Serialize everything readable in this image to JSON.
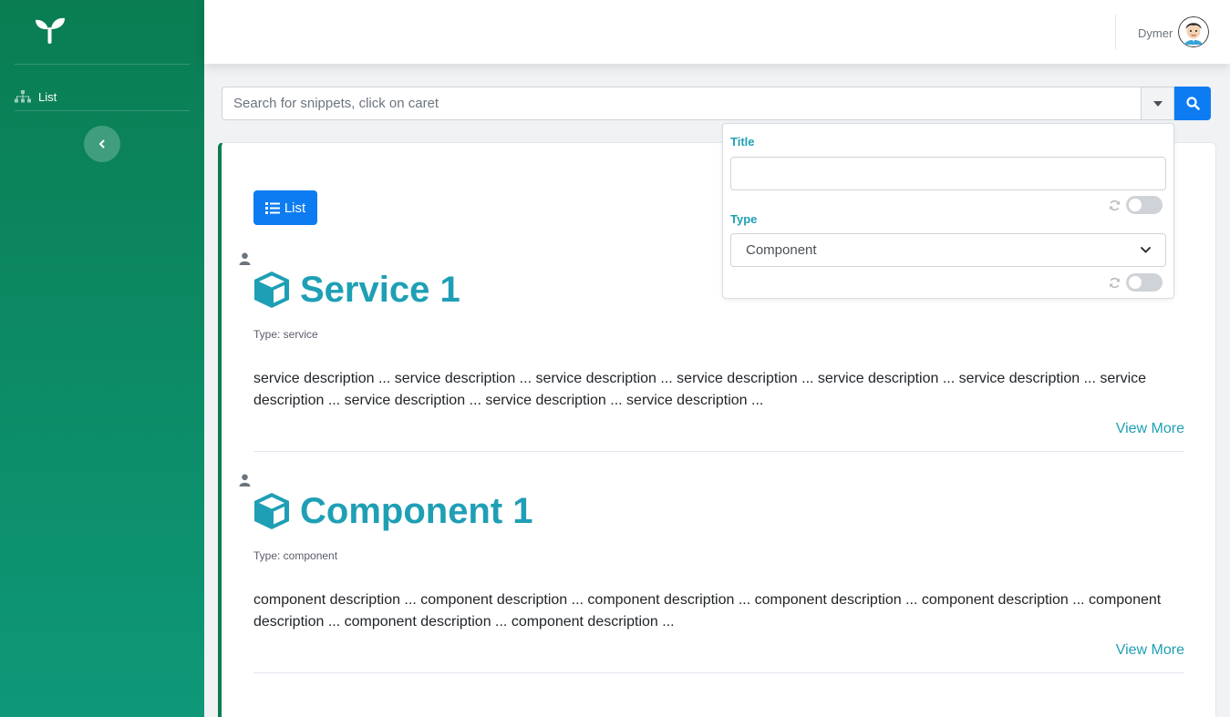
{
  "sidebar": {
    "brand_icon": "sprout-icon",
    "items": [
      {
        "label": "List",
        "icon": "sitemap-icon"
      }
    ],
    "collapse_icon": "chevron-left-icon"
  },
  "topbar": {
    "user_name": "Dymer",
    "avatar_icon": "user-avatar"
  },
  "search": {
    "placeholder": "Search for snippets, click on caret",
    "caret_icon": "caret-down-icon",
    "button_icon": "search-icon"
  },
  "filter_panel": {
    "title_label": "Title",
    "title_value": "",
    "type_label": "Type",
    "type_selected": "Component"
  },
  "main": {
    "list_button_label": "List",
    "items": [
      {
        "title": "Service 1",
        "type": "Type: service",
        "description": "service description ... service description ... service description ... service description ... service description ... service description ... service description ... service description ... service description ... service description ...",
        "more": "View More"
      },
      {
        "title": "Component 1",
        "type": "Type: component",
        "description": "component description ... component description ... component description ... component description ... component description ... component description ... component description ... component description ...",
        "more": "View More"
      }
    ]
  },
  "colors": {
    "sidebar": "#0a7d52",
    "accent": "#1f9fb5",
    "primary": "#0d7cf2"
  }
}
